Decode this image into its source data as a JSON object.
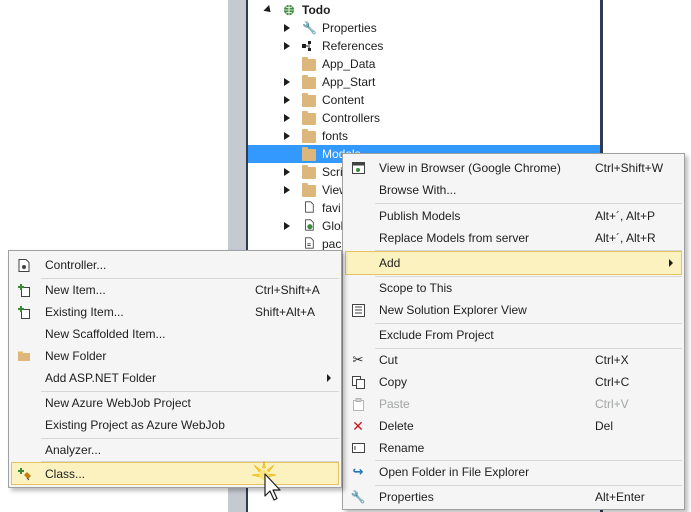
{
  "tree": {
    "project": "Todo",
    "items": [
      {
        "label": "Properties"
      },
      {
        "label": "References"
      },
      {
        "label": "App_Data"
      },
      {
        "label": "App_Start"
      },
      {
        "label": "Content"
      },
      {
        "label": "Controllers"
      },
      {
        "label": "fonts"
      },
      {
        "label": "Models"
      },
      {
        "label": "Scri"
      },
      {
        "label": "View"
      },
      {
        "label": "favi"
      },
      {
        "label": "Glol"
      },
      {
        "label": "pac"
      }
    ]
  },
  "context_menu": {
    "items": [
      {
        "label": "View in Browser (Google Chrome)",
        "shortcut": "Ctrl+Shift+W"
      },
      {
        "label": "Browse With...",
        "shortcut": ""
      },
      {
        "label": "Publish Models",
        "shortcut": "Alt+´, Alt+P"
      },
      {
        "label": "Replace Models from server",
        "shortcut": "Alt+´, Alt+R"
      },
      {
        "label": "Add",
        "shortcut": ""
      },
      {
        "label": "Scope to This",
        "shortcut": ""
      },
      {
        "label": "New Solution Explorer View",
        "shortcut": ""
      },
      {
        "label": "Exclude From Project",
        "shortcut": ""
      },
      {
        "label": "Cut",
        "shortcut": "Ctrl+X"
      },
      {
        "label": "Copy",
        "shortcut": "Ctrl+C"
      },
      {
        "label": "Paste",
        "shortcut": "Ctrl+V"
      },
      {
        "label": "Delete",
        "shortcut": "Del"
      },
      {
        "label": "Rename",
        "shortcut": ""
      },
      {
        "label": "Open Folder in File Explorer",
        "shortcut": ""
      },
      {
        "label": "Properties",
        "shortcut": "Alt+Enter"
      }
    ]
  },
  "add_submenu": {
    "items": [
      {
        "label": "Controller...",
        "shortcut": ""
      },
      {
        "label": "New Item...",
        "shortcut": "Ctrl+Shift+A"
      },
      {
        "label": "Existing Item...",
        "shortcut": "Shift+Alt+A"
      },
      {
        "label": "New Scaffolded Item...",
        "shortcut": ""
      },
      {
        "label": "New Folder",
        "shortcut": ""
      },
      {
        "label": "Add ASP.NET Folder",
        "shortcut": ""
      },
      {
        "label": "New Azure WebJob Project",
        "shortcut": ""
      },
      {
        "label": "Existing Project as Azure WebJob",
        "shortcut": ""
      },
      {
        "label": "Analyzer...",
        "shortcut": ""
      },
      {
        "label": "Class...",
        "shortcut": ""
      }
    ]
  },
  "colors": {
    "selection": "#3399ff",
    "menu_highlight": "#fcf2bf",
    "menu_highlight_border": "#e5c365",
    "frame": "#2f3b53"
  }
}
